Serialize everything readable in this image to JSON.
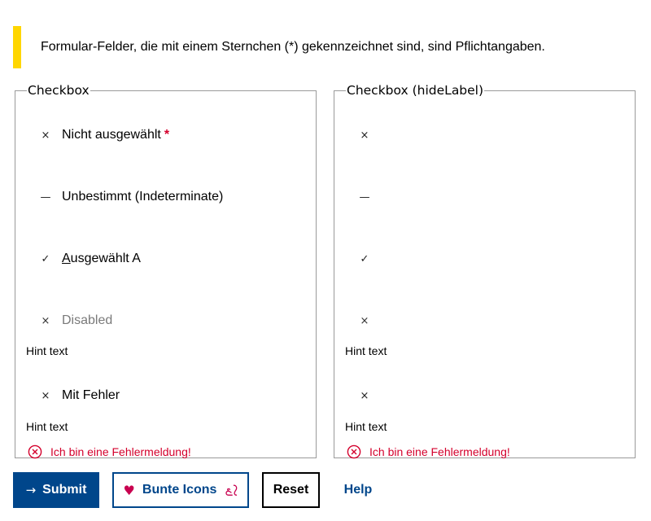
{
  "notice": {
    "text": "Formular-Felder, die mit einem Sternchen (*) gekennzeichnet sind, sind Pflichtangaben."
  },
  "groups": [
    {
      "legend": "Checkbox",
      "items": [
        {
          "label": "Nicht ausgewählt",
          "required_mark": "*",
          "state": "unchecked",
          "glyph": "×"
        },
        {
          "label": "Unbestimmt (Indeterminate)",
          "state": "indeterminate",
          "glyph": "—"
        },
        {
          "label_accel": "A",
          "label_rest": "usgewählt A",
          "state": "checked",
          "glyph": "✓"
        },
        {
          "label": "Disabled",
          "state": "unchecked-disabled",
          "glyph": "×",
          "hint": "Hint text"
        },
        {
          "label": "Mit Fehler",
          "state": "unchecked",
          "glyph": "×",
          "hint": "Hint text",
          "error": "Ich bin eine Fehlermeldung!"
        }
      ]
    },
    {
      "legend": "Checkbox (hideLabel)",
      "items": [
        {
          "state": "unchecked",
          "glyph": "×"
        },
        {
          "state": "indeterminate",
          "glyph": "—"
        },
        {
          "state": "checked",
          "glyph": "✓"
        },
        {
          "state": "unchecked-disabled",
          "glyph": "×",
          "hint": "Hint text"
        },
        {
          "state": "unchecked",
          "glyph": "×",
          "hint": "Hint text",
          "error": "Ich bin eine Fehlermeldung!"
        }
      ]
    }
  ],
  "buttons": {
    "submit": "Submit",
    "icons": "Bunte Icons",
    "reset": "Reset",
    "help": "Help"
  },
  "icons": {
    "submit": "arrow-right-icon",
    "icons_left": "heart-icon",
    "icons_right": "squirrel-icon",
    "error": "error-circle-x-icon"
  },
  "colors": {
    "primary": "#00468b",
    "error": "#d4002c",
    "notice_accent": "#ffd600",
    "heart": "#c8004f"
  }
}
